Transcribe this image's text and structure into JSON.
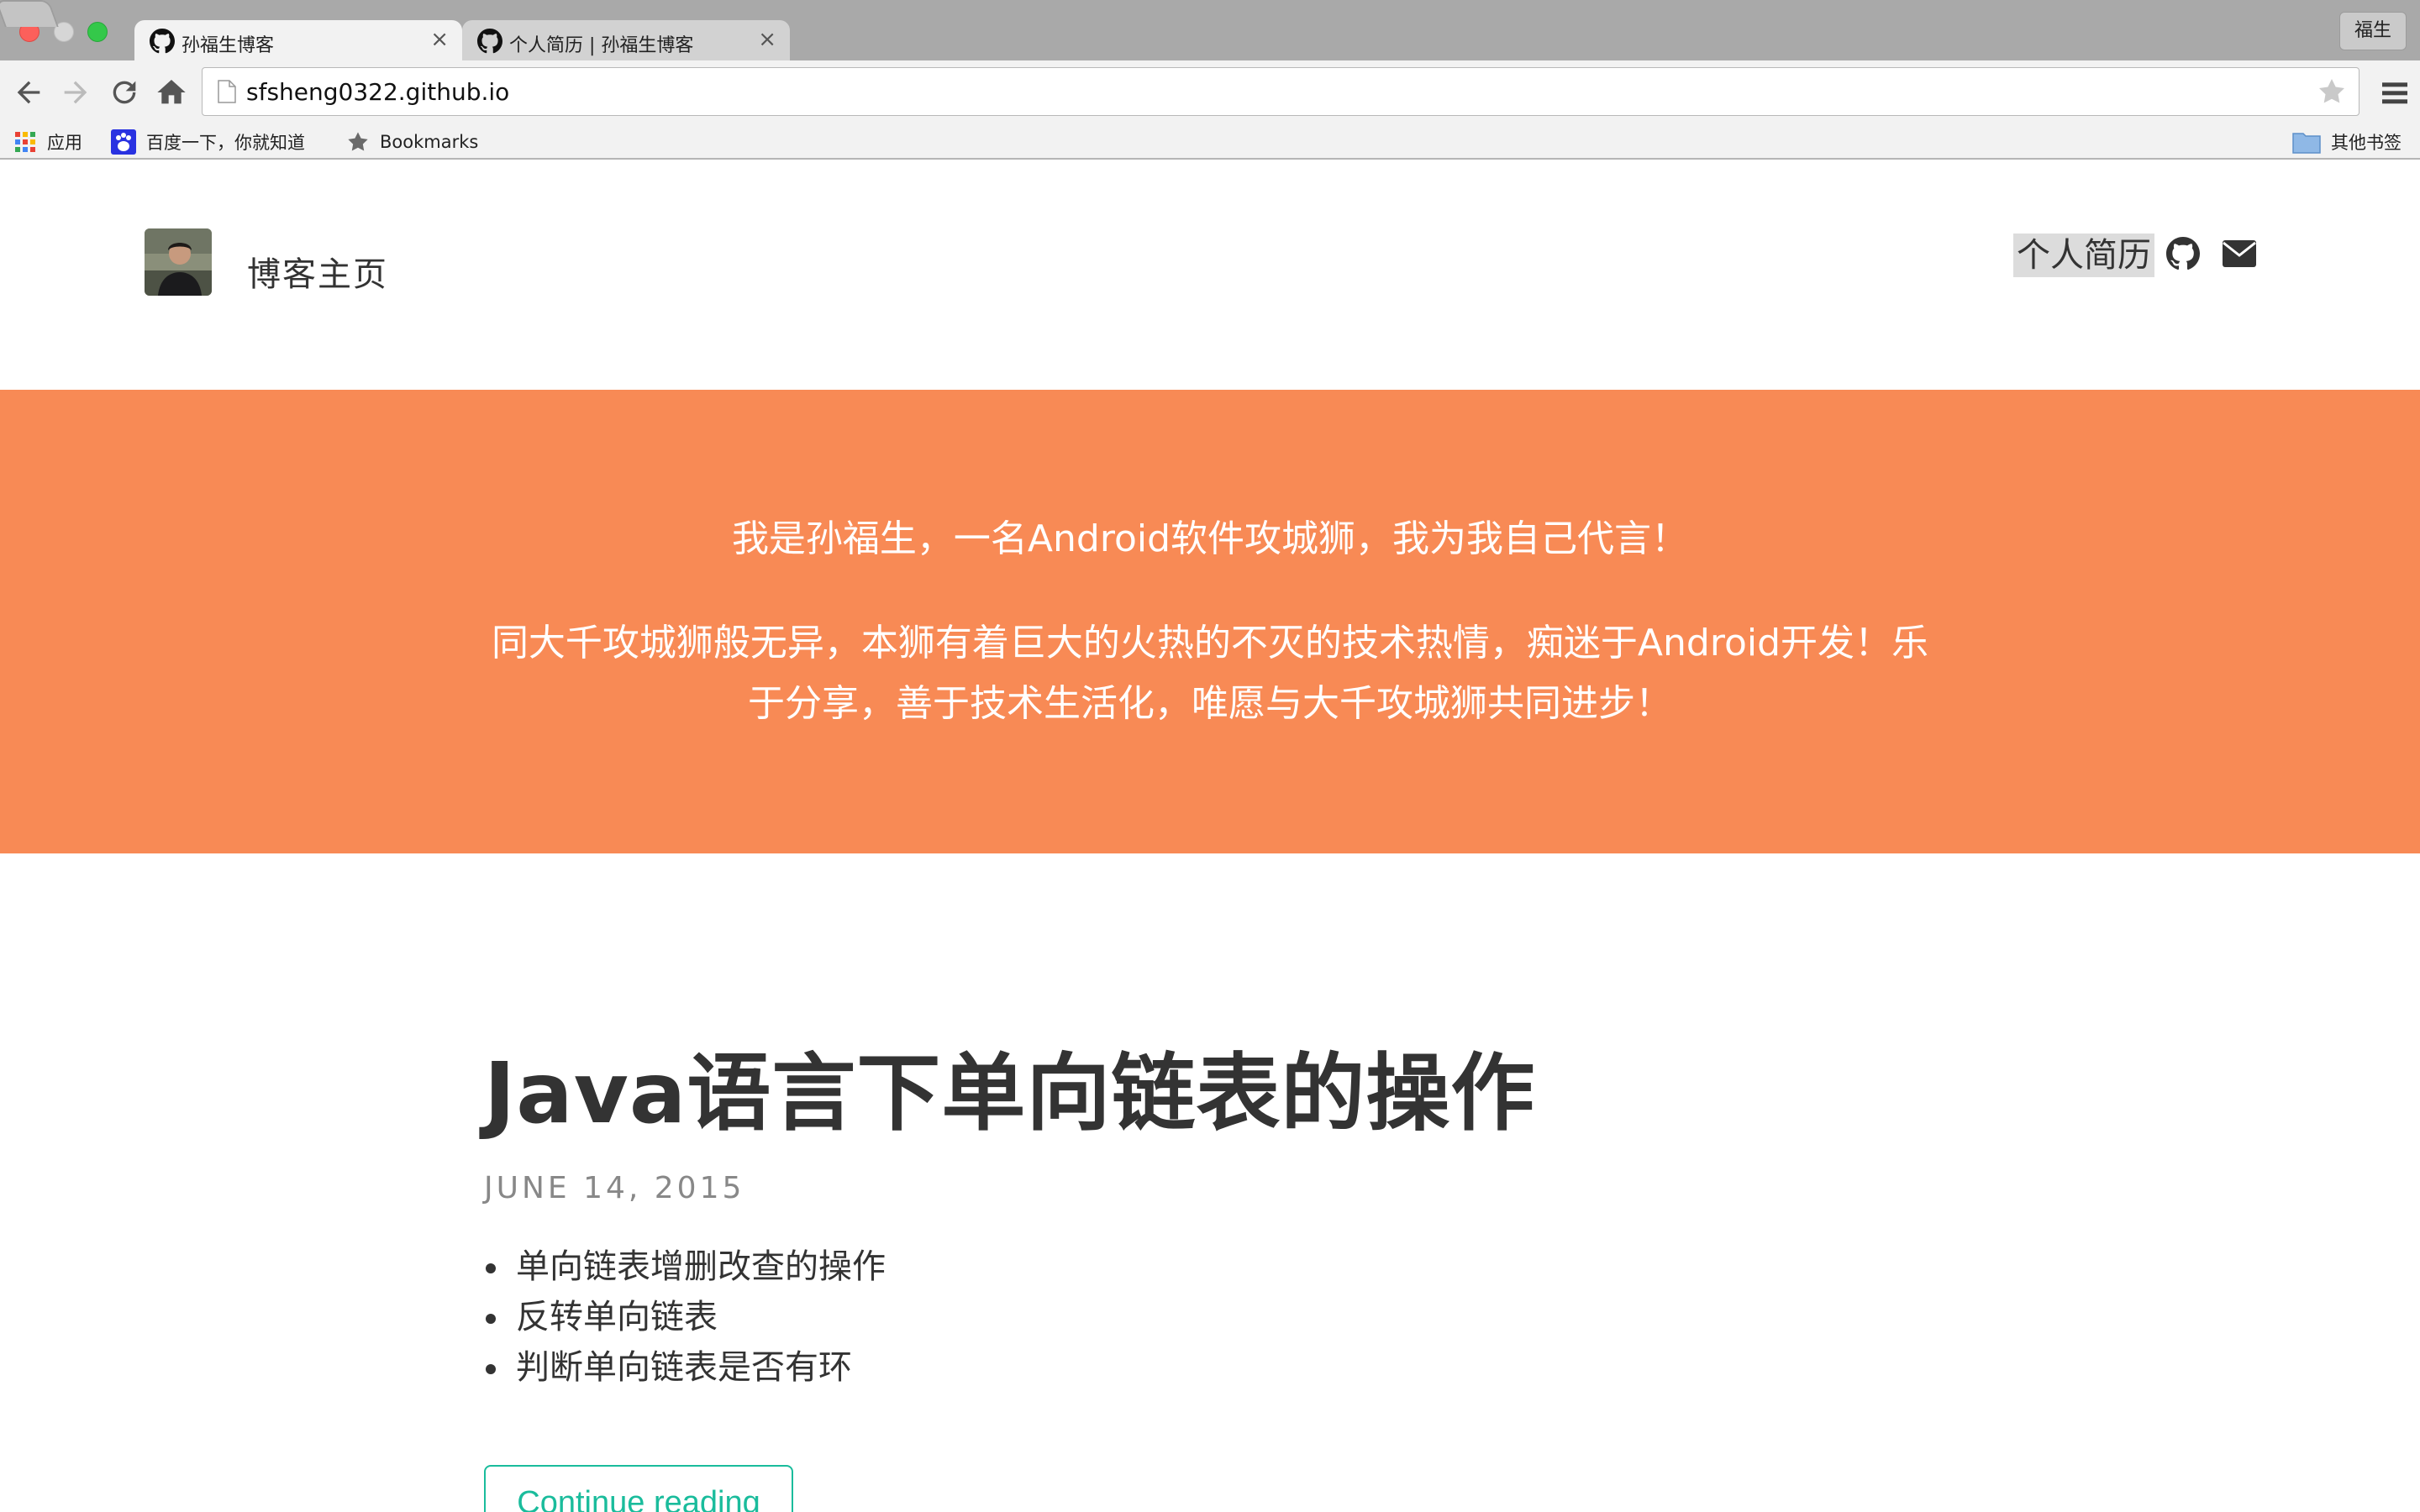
{
  "browser": {
    "tabs": [
      {
        "title": "孙福生博客",
        "icon": "github-icon",
        "active": true,
        "close": "×"
      },
      {
        "title": "个人简历 | 孙福生博客",
        "icon": "github-icon",
        "active": false,
        "close": "×"
      }
    ],
    "profile_name": "福生",
    "url": "sfsheng0322.github.io",
    "bookmarks": [
      {
        "label": "应用",
        "icon": "apps-grid-icon"
      },
      {
        "label": "百度一下，你就知道",
        "icon": "baidu-paw-icon"
      },
      {
        "label": "Bookmarks",
        "icon": "star-icon"
      }
    ],
    "other_bookmarks": {
      "label": "其他书签",
      "icon": "folder-icon"
    }
  },
  "header": {
    "site_title": "博客主页",
    "nav": {
      "resume": "个人简历",
      "github_icon": "github-icon",
      "mail_icon": "envelope-icon"
    }
  },
  "hero": {
    "line1": "我是孙福生，一名Android软件攻城狮，我为我自己代言！",
    "line2": "同大千攻城狮般无异，本狮有着巨大的火热的不灭的技术热情，痴迷于Android开发！乐于分享，善于技术生活化，唯愿与大千攻城狮共同进步！",
    "background": "#f88a55"
  },
  "post": {
    "title": "Java语言下单向链表的操作",
    "date": "JUNE 14, 2015",
    "items": [
      "单向链表增删改查的操作",
      "反转单向链表",
      "判断单向链表是否有环"
    ],
    "continue_label": "Continue reading",
    "accent": "#1abc9c"
  }
}
